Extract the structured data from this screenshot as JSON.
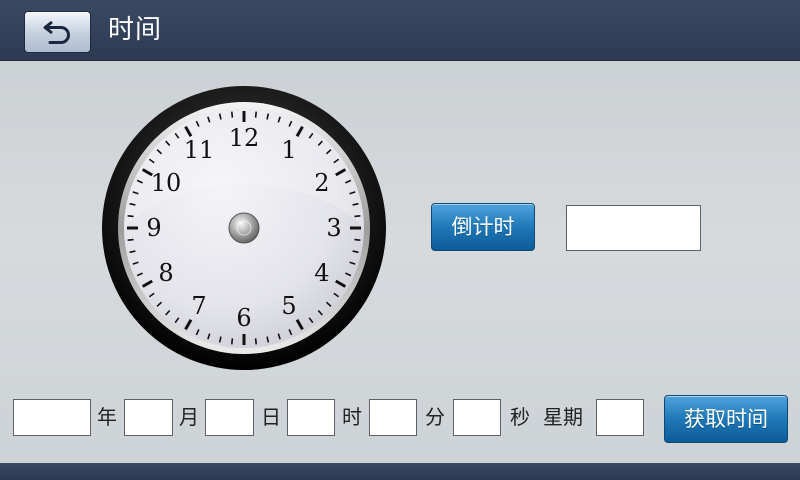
{
  "header": {
    "title": "时间",
    "back_icon": "back-arrow-icon"
  },
  "clock": {
    "numerals": [
      "12",
      "1",
      "2",
      "3",
      "4",
      "5",
      "6",
      "7",
      "8",
      "9",
      "10",
      "11"
    ]
  },
  "countdown": {
    "button_label": "倒计时",
    "value": ""
  },
  "datetime": {
    "year_value": "",
    "year_label": "年",
    "month_value": "",
    "month_label": "月",
    "day_value": "",
    "day_label": "日",
    "hour_value": "",
    "hour_label": "时",
    "minute_value": "",
    "minute_label": "分",
    "second_value": "",
    "second_label": "秒",
    "weekday_label": "星期",
    "weekday_value": "",
    "get_time_label": "获取时间"
  },
  "colors": {
    "header_bg": "#2c3a52",
    "button_blue": "#1f78b8",
    "panel_bg": "#d0d4d8"
  }
}
